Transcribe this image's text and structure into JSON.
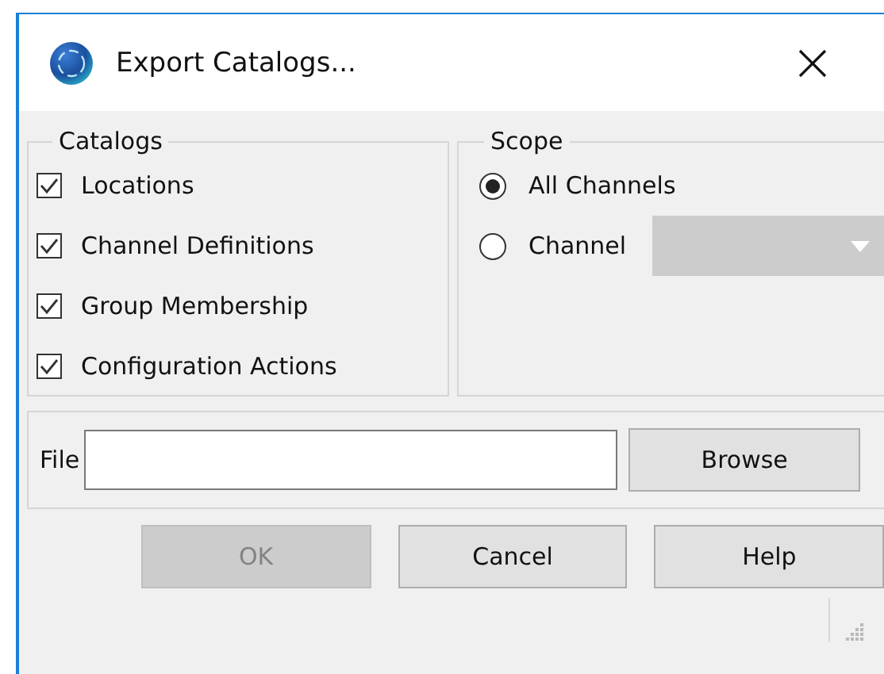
{
  "window": {
    "title": "Export Catalogs..."
  },
  "catalogs": {
    "title": "Catalogs",
    "items": [
      {
        "label": "Locations",
        "checked": true
      },
      {
        "label": "Channel Definitions",
        "checked": true
      },
      {
        "label": "Group Membership",
        "checked": true
      },
      {
        "label": "Configuration Actions",
        "checked": true
      }
    ]
  },
  "scope": {
    "title": "Scope",
    "options": [
      {
        "label": "All Channels",
        "selected": true,
        "kind": "plain"
      },
      {
        "label": "Channel",
        "selected": false,
        "kind": "dropdown",
        "dropdown_disabled": true
      }
    ]
  },
  "file": {
    "label": "File",
    "browse": "Browse"
  },
  "buttons": [
    {
      "label": "OK",
      "disabled": true
    },
    {
      "label": "Cancel",
      "disabled": false
    },
    {
      "label": "Help",
      "disabled": false
    }
  ]
}
